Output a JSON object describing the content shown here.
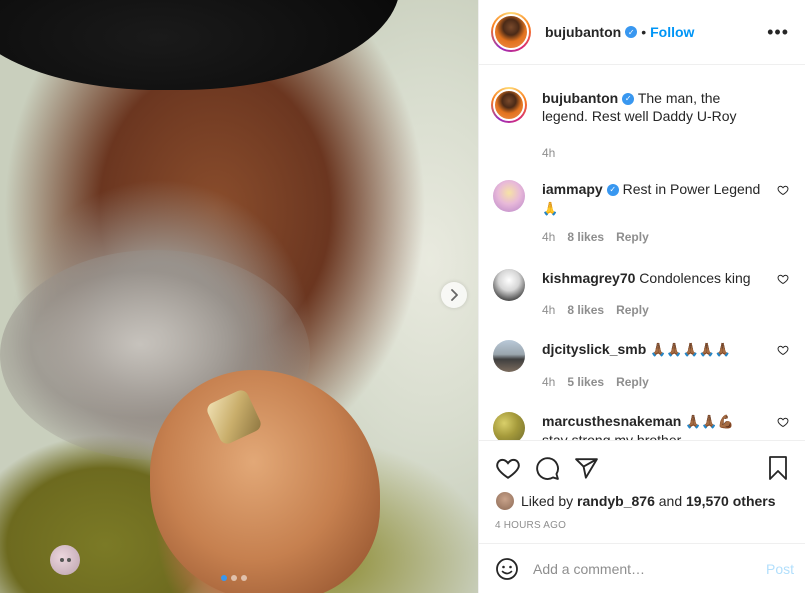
{
  "post": {
    "username": "bujubanton",
    "follow_label": "Follow",
    "separator": "•",
    "more_label": "•••",
    "caption": "The man, the legend. Rest well Daddy U-Roy",
    "caption_time": "4h",
    "carousel_slides": 3,
    "carousel_active": 1
  },
  "comments": [
    {
      "username": "iammapy",
      "verified": true,
      "text": "Rest in Power Legend",
      "emoji": "🙏",
      "time": "4h",
      "likes": "8 likes",
      "reply": "Reply"
    },
    {
      "username": "kishmagrey70",
      "verified": false,
      "text": "Condolences king",
      "emoji": "",
      "time": "4h",
      "likes": "8 likes",
      "reply": "Reply"
    },
    {
      "username": "djcityslick_smb",
      "verified": false,
      "text": "",
      "emoji": "🙏🏾🙏🏾🙏🏾🙏🏾🙏🏾",
      "time": "4h",
      "likes": "5 likes",
      "reply": "Reply"
    },
    {
      "username": "marcusthesnakeman",
      "verified": false,
      "text": "stay strong my brother",
      "emoji": "🙏🏾🙏🏾💪🏾",
      "time": "",
      "likes": "",
      "reply": ""
    }
  ],
  "likes": {
    "prefix": "Liked by",
    "user": "randyb_876",
    "and": "and",
    "count": "19,570 others"
  },
  "timestamp": "4 HOURS AGO",
  "comment_box": {
    "placeholder": "Add a comment…",
    "post_label": "Post"
  },
  "colors": {
    "accent": "#0095f6",
    "post_disabled": "#b2dffc",
    "muted": "#8e8e8e"
  }
}
